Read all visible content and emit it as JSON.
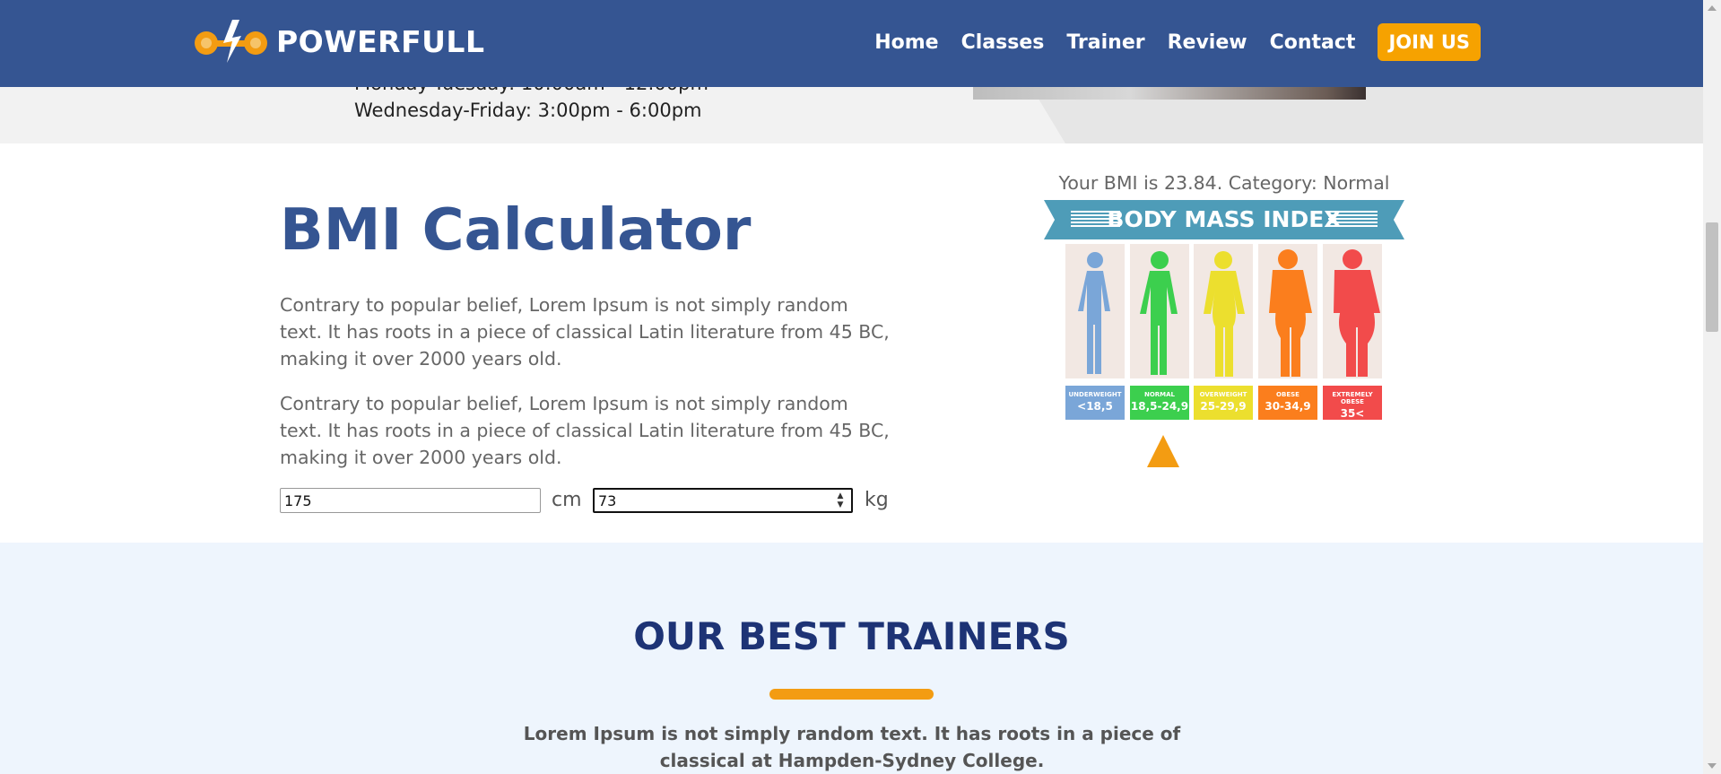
{
  "header": {
    "brand": "POWERFULL",
    "nav": [
      {
        "label": "Home"
      },
      {
        "label": "Classes"
      },
      {
        "label": "Trainer"
      },
      {
        "label": "Review"
      },
      {
        "label": "Contact"
      }
    ],
    "cta_label": "JOIN US"
  },
  "schedule": {
    "line1": "Monday-Tuesday: 10:00am - 12:00pm",
    "line2": "Wednesday-Friday: 3:00pm - 6:00pm"
  },
  "bmi": {
    "title": "BMI Calculator",
    "paragraphs": [
      "Contrary to popular belief, Lorem Ipsum is not simply random text. It has roots in a piece of classical Latin literature from 45 BC, making it over 2000 years old.",
      "Contrary to popular belief, Lorem Ipsum is not simply random text. It has roots in a piece of classical Latin literature from 45 BC, making it over 2000 years old."
    ],
    "height_value": "175",
    "height_unit": "cm",
    "weight_value": "73",
    "weight_unit": "kg",
    "result_text": "Your BMI is 23.84. Category: Normal",
    "chart_title": "BODY MASS INDEX",
    "categories": [
      {
        "name": "UNDERWEIGHT",
        "range": "<18,5",
        "color": "#7aa6d8"
      },
      {
        "name": "NORMAL",
        "range": "18,5-24,9",
        "color": "#3ccf4e"
      },
      {
        "name": "OVERWEIGHT",
        "range": "25-29,9",
        "color": "#ecdf2e"
      },
      {
        "name": "OBESE",
        "range": "30-34,9",
        "color": "#fb7e1d"
      },
      {
        "name": "EXTREMELY OBESE",
        "range": "35<",
        "color": "#f24b4b"
      }
    ],
    "pointer_color": "#f39c12"
  },
  "trainers": {
    "title": "OUR BEST TRAINERS",
    "subtitle": "Lorem Ipsum is not simply random text. It has roots in a piece of classical at Hampden-Sydney College."
  },
  "colors": {
    "header_bg": "#355592",
    "accent": "#f6a200",
    "title_blue": "#355592"
  }
}
